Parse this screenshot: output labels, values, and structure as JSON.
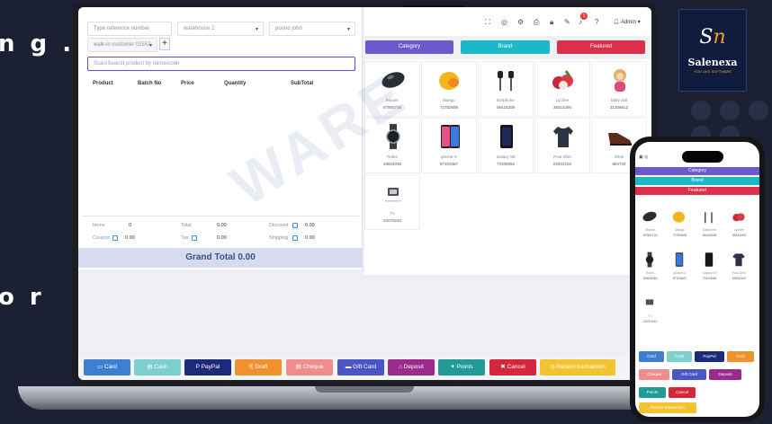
{
  "background": {
    "text_top": "n g .",
    "text_bottom": "o r"
  },
  "pos": {
    "inputs": {
      "ref_placeholder": "Type reference number",
      "warehouse_value": "warehouse 2",
      "product_value": "pound johd",
      "customer_value": "walk-in customer 01552"
    },
    "scan_placeholder": "Scan/Search product by name/code",
    "table_headers": [
      "Product",
      "Batch No",
      "Price",
      "Quantity",
      "SubTotal"
    ],
    "summary": {
      "items_label": "Items",
      "items_value": "0",
      "total_label": "Total",
      "total_value": "0.00",
      "discount_label": "Discount",
      "discount_value": "0.00",
      "coupon_label": "Coupon",
      "coupon_value": "0.00",
      "tax_label": "Tax",
      "tax_value": "0.00",
      "shipping_label": "Shipping",
      "shipping_value": "0.00"
    },
    "grand_total": "Grand Total 0.00",
    "topbar": {
      "admin": "Admin"
    },
    "filters": [
      {
        "label": "Category",
        "color": "#6a5acd"
      },
      {
        "label": "Brand",
        "color": "#1cb7c9"
      },
      {
        "label": "Featured",
        "color": "#dc2f4a"
      }
    ],
    "products": [
      {
        "name": "Mouse",
        "code": "87900716",
        "icon": "mouse-icon"
      },
      {
        "name": "Mango",
        "code": "72782608",
        "icon": "mango-icon"
      },
      {
        "name": "Earphone",
        "code": "06416208",
        "icon": "earphone-icon"
      },
      {
        "name": "Lychee",
        "code": "38314290",
        "icon": "lychee-icon"
      },
      {
        "name": "baby doll",
        "code": "31306812",
        "icon": "doll-icon"
      },
      {
        "name": "Rolex",
        "code": "40624036",
        "icon": "watch-icon"
      },
      {
        "name": "iphone-X",
        "code": "87103467",
        "icon": "phone-icon"
      },
      {
        "name": "Galaxy S9",
        "code": "73100066",
        "icon": "phone-dark-icon"
      },
      {
        "name": "Polo Shirt",
        "code": "53402102",
        "icon": "shirt-icon"
      },
      {
        "name": "Shoe",
        "code": "884734",
        "icon": "shoe-icon"
      },
      {
        "name": "Tv",
        "code": "22070242",
        "icon": "tv-icon"
      }
    ],
    "actions": [
      {
        "label": "Card",
        "color": "#3f7fd1",
        "icon": "card-icon"
      },
      {
        "label": "Cash",
        "color": "#7ccfce",
        "icon": "cash-icon"
      },
      {
        "label": "PayPal",
        "color": "#1d2a7a",
        "icon": "paypal-icon"
      },
      {
        "label": "Draft",
        "color": "#f0912e",
        "icon": "draft-icon"
      },
      {
        "label": "Cheque",
        "color": "#f08c8c",
        "icon": "cheque-icon"
      },
      {
        "label": "Gift Card",
        "color": "#4a55c6",
        "icon": "gift-card-icon"
      },
      {
        "label": "Deposit",
        "color": "#9b2a8c",
        "icon": "deposit-icon"
      },
      {
        "label": "Points",
        "color": "#229a98",
        "icon": "points-icon"
      },
      {
        "label": "Cancel",
        "color": "#d6263a",
        "icon": "cancel-icon"
      },
      {
        "label": "Recent transaction",
        "color": "#f4c430",
        "icon": "clock-icon"
      }
    ]
  },
  "phone": {
    "filters": [
      "Category",
      "Brand",
      "Featured"
    ],
    "products": [
      {
        "name": "Mouse",
        "code": "87900716"
      },
      {
        "name": "Mango",
        "code": "72782608"
      },
      {
        "name": "Earphone",
        "code": "06416208"
      },
      {
        "name": "Lychee",
        "code": "38314290"
      },
      {
        "name": "baby doll",
        "code": "31306812"
      },
      {
        "name": "Rolex",
        "code": "40624036"
      },
      {
        "name": "iphone-X",
        "code": "87103467"
      },
      {
        "name": "Galaxy S9",
        "code": "73100066"
      },
      {
        "name": "Polo Shirt",
        "code": "53402102"
      },
      {
        "name": "Shoe",
        "code": "884734"
      },
      {
        "name": "Tv",
        "code": "22070242"
      }
    ],
    "actions": [
      "Card",
      "Cash",
      "PayPal",
      "Draft",
      "Cheque",
      "Gift Card",
      "Deposit",
      "Points",
      "Cancel",
      "Recent transaction"
    ]
  },
  "logo": {
    "mark": "Sn",
    "name": "Salenexa",
    "tagline": "YOU LIKE SOFTWARE"
  },
  "watermark": "WARE"
}
